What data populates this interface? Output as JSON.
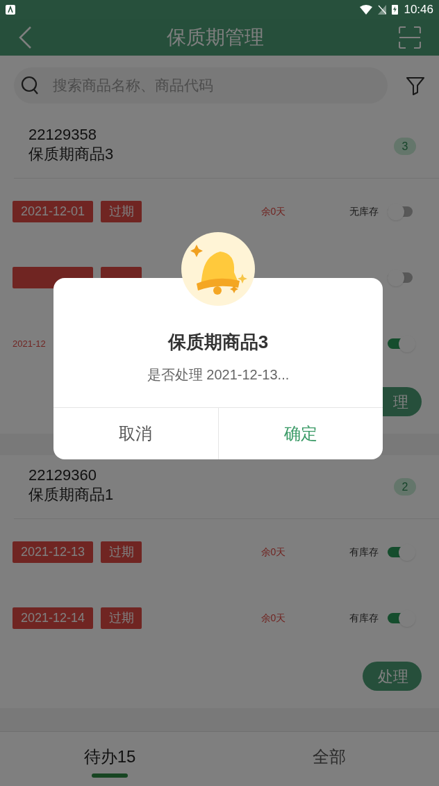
{
  "status_bar": {
    "time": "10:46"
  },
  "header": {
    "title": "保质期管理"
  },
  "search": {
    "placeholder": "搜索商品名称、商品代码"
  },
  "products": [
    {
      "code": "22129358",
      "name": "保质期商品3",
      "count": "3",
      "action": "理",
      "batches": [
        {
          "kind": "tag",
          "date": "2021-12-01",
          "tag": "过期",
          "remaining": "余0天",
          "stock_label": "无库存",
          "on": false
        },
        {
          "kind": "tag",
          "on": false
        },
        {
          "kind": "text",
          "date": "2021-12",
          "on": true
        }
      ]
    },
    {
      "code": "22129360",
      "name": "保质期商品1",
      "count": "2",
      "action": "处理",
      "batches": [
        {
          "kind": "tag",
          "date": "2021-12-13",
          "tag": "过期",
          "remaining": "余0天",
          "stock_label": "有库存",
          "on": true
        },
        {
          "kind": "tag",
          "date": "2021-12-14",
          "tag": "过期",
          "remaining": "余0天",
          "stock_label": "有库存",
          "on": true
        }
      ]
    }
  ],
  "tabs": [
    {
      "label": "待办15",
      "selected": true
    },
    {
      "label": "全部",
      "selected": false
    }
  ],
  "dialog": {
    "title": "保质期商品3",
    "message": "是否处理 2021-12-13...",
    "buttons": [
      {
        "label": "取消",
        "kind": "cancel"
      },
      {
        "label": "确定",
        "kind": "confirm"
      }
    ]
  }
}
